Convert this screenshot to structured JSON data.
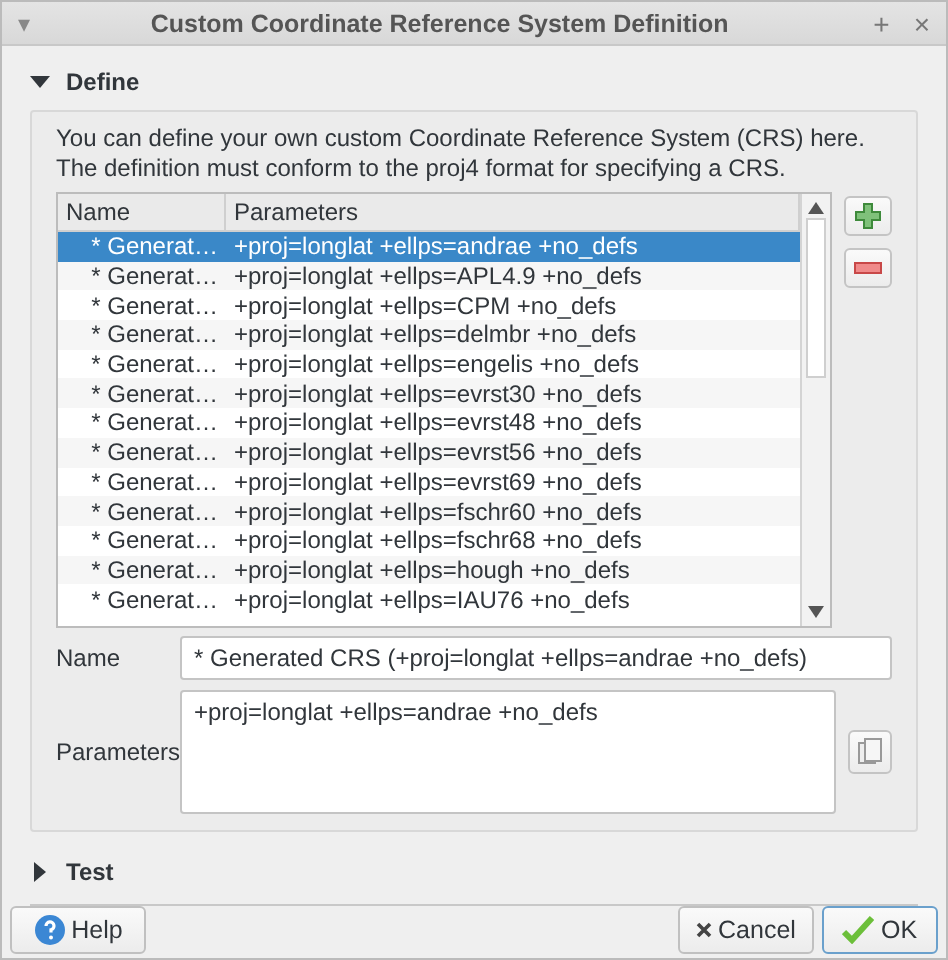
{
  "window": {
    "title": "Custom Coordinate Reference System Definition",
    "menu_glyph": "▾",
    "buttons": [
      "+",
      "×"
    ]
  },
  "define": {
    "title": "Define",
    "expanded": true,
    "description": "You can define your own custom Coordinate Reference System (CRS) here. The definition must conform to the proj4 format for specifying a CRS.",
    "table": {
      "columns": [
        "Name",
        "Parameters"
      ],
      "rows": [
        {
          "name": "* Generat…",
          "parameters": "+proj=longlat +ellps=andrae +no_defs",
          "selected": true
        },
        {
          "name": "* Generat…",
          "parameters": "+proj=longlat +ellps=APL4.9 +no_defs",
          "selected": false
        },
        {
          "name": "* Generat…",
          "parameters": "+proj=longlat +ellps=CPM +no_defs",
          "selected": false
        },
        {
          "name": "* Generat…",
          "parameters": "+proj=longlat +ellps=delmbr +no_defs",
          "selected": false
        },
        {
          "name": "* Generat…",
          "parameters": "+proj=longlat +ellps=engelis +no_defs",
          "selected": false
        },
        {
          "name": "* Generat…",
          "parameters": "+proj=longlat +ellps=evrst30 +no_defs",
          "selected": false
        },
        {
          "name": "* Generat…",
          "parameters": "+proj=longlat +ellps=evrst48 +no_defs",
          "selected": false
        },
        {
          "name": "* Generat…",
          "parameters": "+proj=longlat +ellps=evrst56 +no_defs",
          "selected": false
        },
        {
          "name": "* Generat…",
          "parameters": "+proj=longlat +ellps=evrst69 +no_defs",
          "selected": false
        },
        {
          "name": "* Generat…",
          "parameters": "+proj=longlat +ellps=fschr60 +no_defs",
          "selected": false
        },
        {
          "name": "* Generat…",
          "parameters": "+proj=longlat +ellps=fschr68 +no_defs",
          "selected": false
        },
        {
          "name": "* Generat…",
          "parameters": "+proj=longlat +ellps=hough +no_defs",
          "selected": false
        },
        {
          "name": "* Generat…",
          "parameters": "+proj=longlat +ellps=IAU76 +no_defs",
          "selected": false
        }
      ]
    },
    "name_label": "Name",
    "name_value": "* Generated CRS (+proj=longlat +ellps=andrae +no_defs)",
    "parameters_label": "Parameters",
    "parameters_value": "+proj=longlat +ellps=andrae +no_defs"
  },
  "test": {
    "title": "Test",
    "expanded": false
  },
  "buttons": [
    {
      "label": "Help",
      "kind": "help"
    },
    {
      "label": "Cancel",
      "kind": "cancel"
    },
    {
      "label": "OK",
      "kind": "ok"
    }
  ]
}
